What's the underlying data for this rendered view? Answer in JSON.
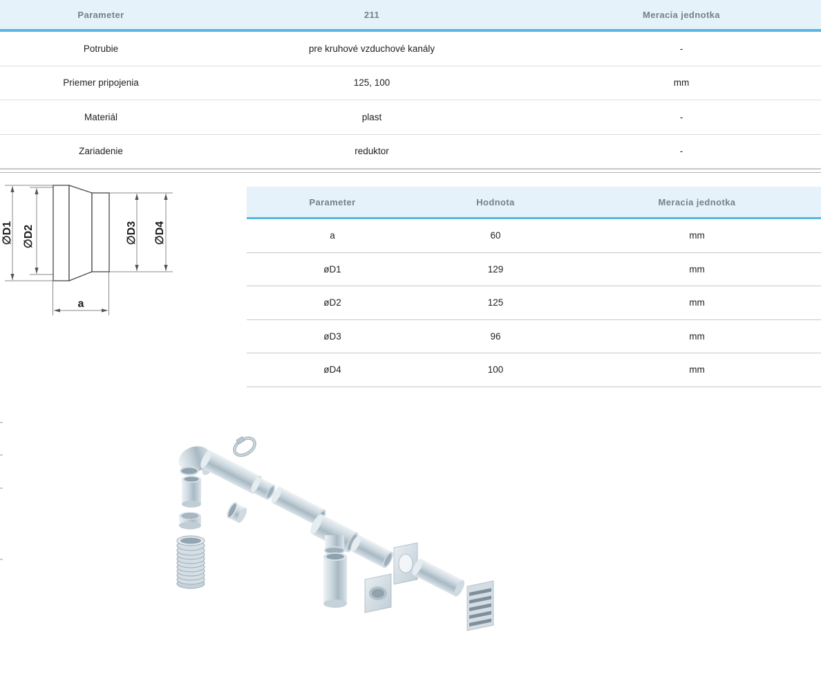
{
  "product_table": {
    "columns": [
      "Parameter",
      "211",
      "Meracia jednotka"
    ],
    "rows": [
      [
        "Potrubie",
        "pre kruhové vzduchové kanály",
        "-"
      ],
      [
        "Priemer pripojenia",
        "125, 100",
        "mm"
      ],
      [
        "Materiál",
        "plast",
        "-"
      ],
      [
        "Zariadenie",
        "reduktor",
        "-"
      ]
    ]
  },
  "dimensions_table": {
    "columns": [
      "Parameter",
      "Hodnota",
      "Meracia jednotka"
    ],
    "rows": [
      [
        "a",
        "60",
        "mm"
      ],
      [
        "øD1",
        "129",
        "mm"
      ],
      [
        "øD2",
        "125",
        "mm"
      ],
      [
        "øD3",
        "96",
        "mm"
      ],
      [
        "øD4",
        "100",
        "mm"
      ]
    ]
  },
  "diagram_labels": {
    "d1": "∅D1",
    "d2": "∅D2",
    "d3": "∅D3",
    "d4": "∅D4",
    "a": "a"
  },
  "colors": {
    "accent_blue": "#56b8e2",
    "header_bg": "#e6f2fa",
    "header_text": "#75808a",
    "row_divider_light": "#dcdcdc",
    "row_divider_dark": "#c6c6c6",
    "double_rule": "#b1b1b1",
    "drawing_outline": "#44484c",
    "dimension_line": "#8a8a8a"
  }
}
